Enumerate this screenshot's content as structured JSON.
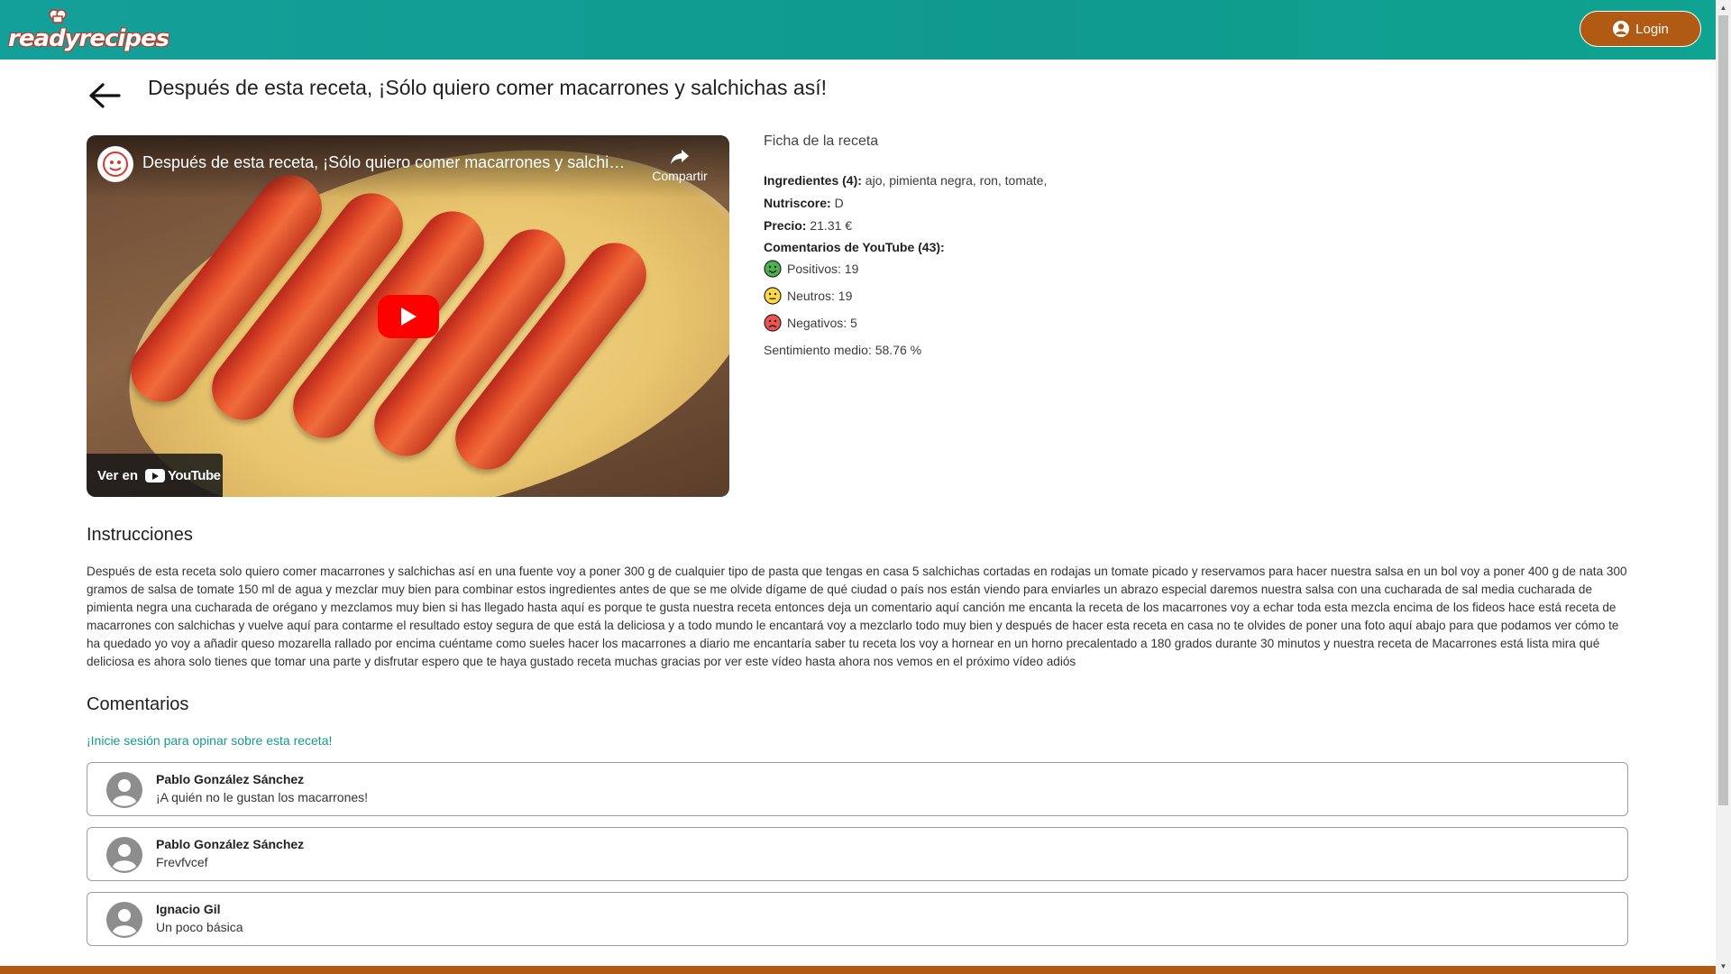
{
  "header": {
    "logo_text": "readyrecipes",
    "login_label": "Login",
    "brand_color": "#0f9a8d",
    "accent_color": "#b15a14"
  },
  "recipe": {
    "title": "Después de esta receta, ¡Sólo quiero comer macarrones y salchichas así!"
  },
  "video": {
    "title": "Después de esta receta, ¡Sólo quiero comer macarrones y salchicha...",
    "share_label": "Compartir",
    "watch_on_label": "Ver en",
    "youtube_label": "YouTube"
  },
  "ficha": {
    "heading": "Ficha de la receta",
    "ingredients_label": "Ingredientes (4):",
    "ingredients_value": "ajo, pimienta negra, ron, tomate,",
    "nutriscore_label": "Nutriscore:",
    "nutriscore_value": "D",
    "price_label": "Precio:",
    "price_value": "21.31 €",
    "comments_label": "Comentarios de YouTube (43):",
    "positive": "Positivos: 19",
    "neutral": "Neutros: 19",
    "negative": "Negativos: 5",
    "sentiment": "Sentimiento medio: 58.76 %"
  },
  "instructions": {
    "heading": "Instrucciones",
    "text": "Después de esta receta solo quiero comer macarrones y salchichas así en una fuente voy a poner 300 g de cualquier tipo de pasta que tengas en casa 5 salchichas cortadas en rodajas un tomate picado y reservamos para hacer nuestra salsa en un bol voy a poner 400 g de nata 300 gramos de salsa de tomate 150 ml de agua y mezclar muy bien para combinar estos ingredientes antes de que se me olvide dígame de qué ciudad o país nos están viendo para enviarles un abrazo especial daremos nuestra salsa con una cucharada de sal media cucharada de pimienta negra una cucharada de orégano y mezclamos muy bien si has llegado hasta aquí es porque te gusta nuestra receta entonces deja un comentario aquí canción me encanta la receta de los macarrones voy a echar toda esta mezcla encima de los fideos hace está receta de macarrones con salchichas y vuelve aquí para contarme el resultado estoy segura de que está la deliciosa y a todo mundo le encantará voy a mezclarlo todo muy bien y después de hacer esta receta en casa no te olvides de poner una foto aquí abajo para que podamos ver cómo te ha quedado yo voy a añadir queso mozarella rallado por encima cuéntame como sueles hacer los macarrones a diario me encantaría saber tu receta los voy a hornear en un horno precalentado a 180 grados durante 30 minutos y nuestra receta de Macarrones está lista mira qué deliciosa es ahora solo tienes que tomar una parte y disfrutar espero que te haya gustado receta muchas gracias por ver este vídeo hasta ahora nos vemos en el próximo vídeo adiós"
  },
  "comments": {
    "heading": "Comentarios",
    "login_prompt": "¡Inicie sesión para opinar sobre esta receta!",
    "items": [
      {
        "author": "Pablo González Sánchez",
        "text": "¡A quién no le gustan los macarrones!"
      },
      {
        "author": "Pablo González Sánchez",
        "text": "Frevfvcef"
      },
      {
        "author": "Ignacio Gil",
        "text": "Un poco básica"
      }
    ]
  }
}
